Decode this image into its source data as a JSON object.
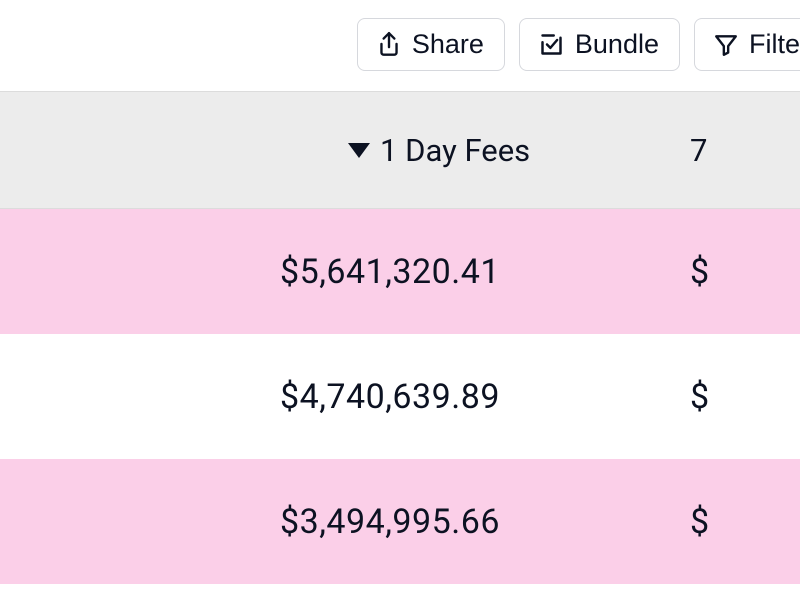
{
  "toolbar": {
    "share_label": "Share",
    "bundle_label": "Bundle",
    "filter_label_visible": "Filte"
  },
  "table": {
    "columns": {
      "one_day_fees": {
        "label": "1 Day Fees",
        "sorted_desc": true
      },
      "next_col_visible_fragment": "7"
    },
    "rows": [
      {
        "one_day_fees": "$5,641,320.41",
        "highlight": true,
        "next_col_fragment": "$"
      },
      {
        "one_day_fees": "$4,740,639.89",
        "highlight": false,
        "next_col_fragment": "$"
      },
      {
        "one_day_fees": "$3,494,995.66",
        "highlight": true,
        "next_col_fragment": "$"
      }
    ]
  }
}
